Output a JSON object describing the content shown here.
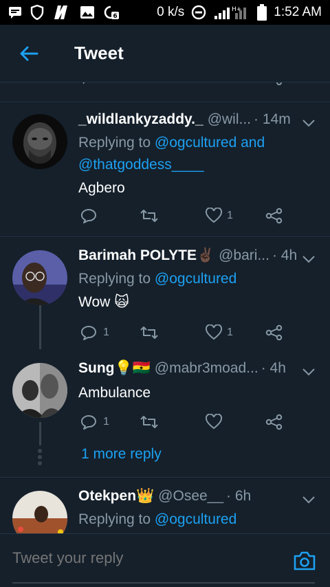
{
  "status_bar": {
    "speed": "0 k/s",
    "network": "H+",
    "time": "1:52 AM"
  },
  "header": {
    "title": "Tweet"
  },
  "tweets": [
    {
      "name": "_wildlankyzaddy._",
      "handle": "@wil...",
      "time": "· 14m",
      "replying_prefix": "Replying to ",
      "replying_to": "@ogcultured and @thatgoddess____",
      "text": "Agbero",
      "reply_count": "",
      "retweet_count": "",
      "like_count": "1"
    },
    {
      "name": "Barimah POLYTE✌🏿",
      "handle": "@bari...",
      "time": "· 4h",
      "replying_prefix": "Replying to ",
      "replying_to": "@ogcultured",
      "text": "Wow 🙀",
      "reply_count": "1",
      "retweet_count": "",
      "like_count": "1"
    },
    {
      "name": "Sung💡🇬🇭",
      "handle": "@mabr3moad...",
      "time": "· 4h",
      "text": "Ambulance",
      "reply_count": "1",
      "retweet_count": "",
      "like_count": ""
    },
    {
      "name": "Otekpen👑",
      "handle": "@Osee__",
      "time": "· 6h",
      "replying_prefix": "Replying to ",
      "replying_to": "@ogcultured"
    }
  ],
  "more_reply": "1 more reply",
  "compose": {
    "placeholder": "Tweet your reply"
  },
  "colors": {
    "background": "#15202b",
    "accent": "#1da1f2",
    "secondary_text": "#8899a6"
  }
}
